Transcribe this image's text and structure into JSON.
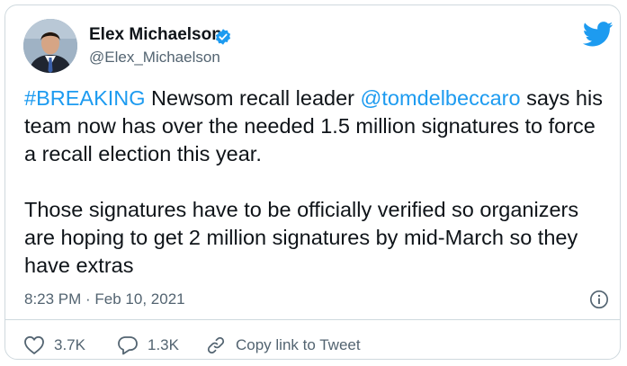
{
  "author": {
    "name": "Elex Michaelson",
    "handle": "@Elex_Michaelson"
  },
  "tweet": {
    "hashtag": "#BREAKING",
    "text_part1": " Newsom recall leader ",
    "mention": "@tomdelbeccaro",
    "text_part2": " says his team now has over the needed 1.5 million signatures to force a recall election this year.",
    "paragraph2": "Those signatures have to be officially verified so organizers are hoping to get 2 million signatures by mid-March so they have extras",
    "timestamp": "8:23 PM · Feb 10, 2021"
  },
  "actions": {
    "likes": "3.7K",
    "replies": "1.3K",
    "copy_link_label": "Copy link to Tweet"
  },
  "icons": [
    "verified-badge-icon",
    "twitter-bird-icon",
    "info-icon",
    "heart-icon",
    "reply-bubble-icon",
    "link-icon"
  ],
  "colors": {
    "accent": "#1d9bf0",
    "text": "#0f1419",
    "secondary": "#536471",
    "border": "#cfd9de"
  }
}
